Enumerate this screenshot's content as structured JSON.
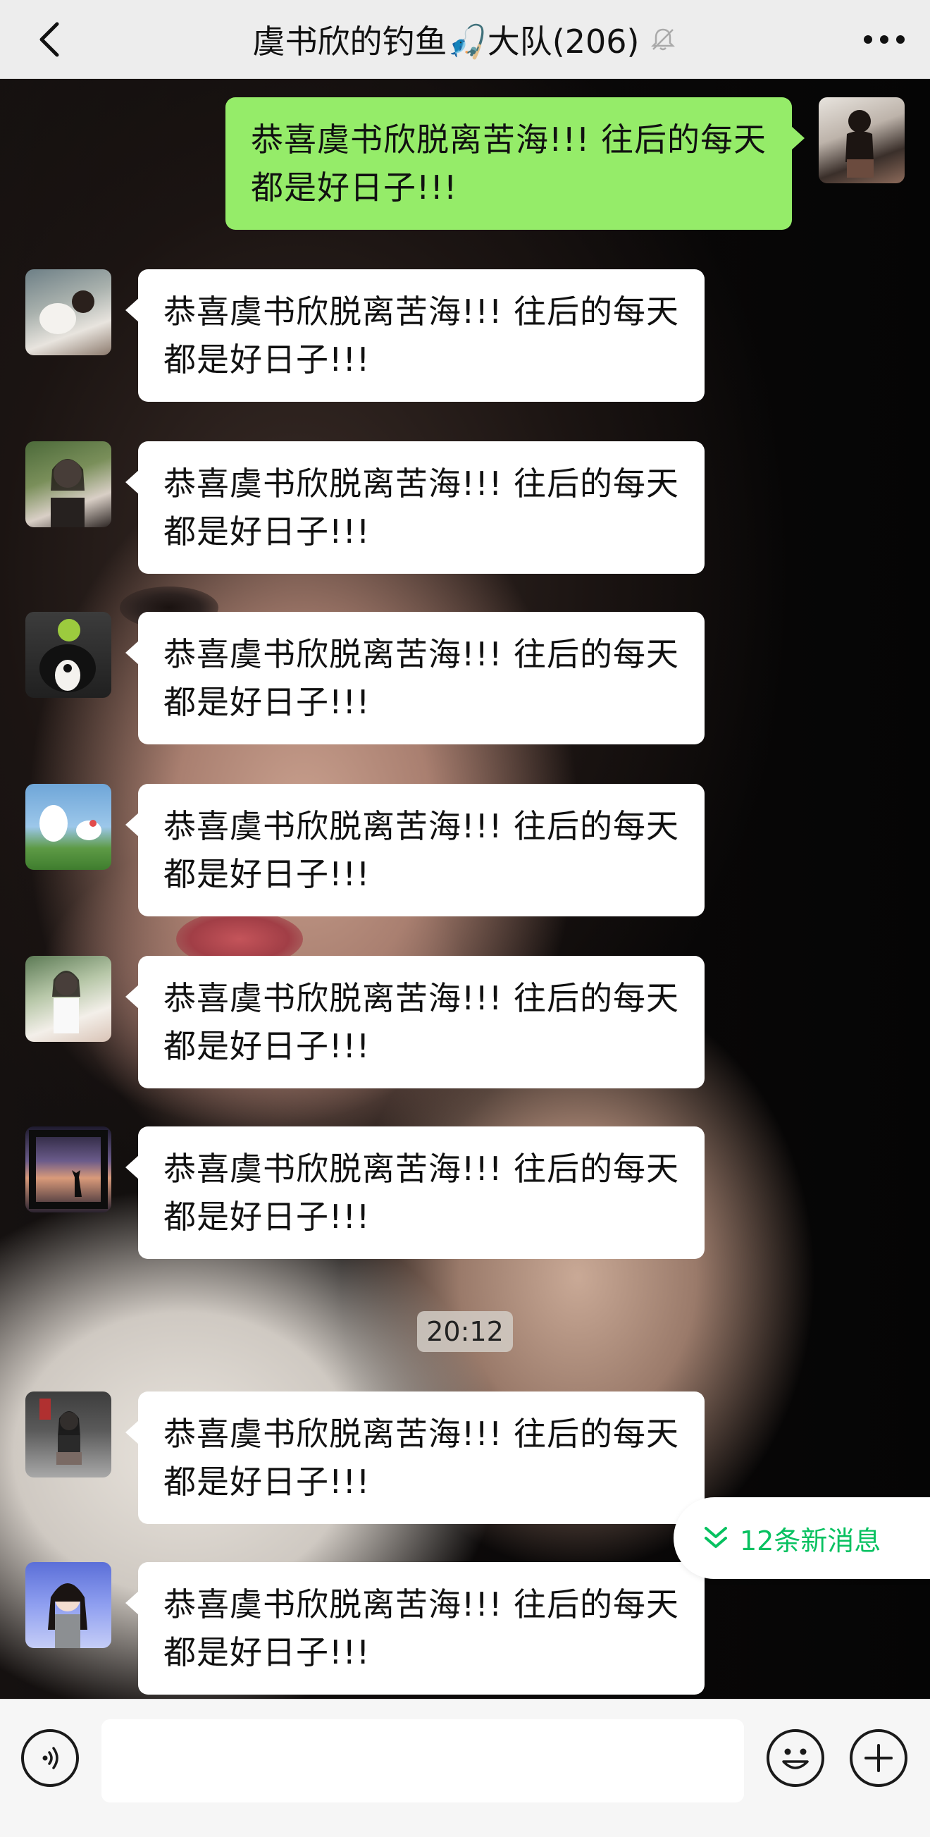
{
  "header": {
    "title": "虞书欣的钓鱼🎣大队(206)",
    "back_icon": "chevron-left-icon",
    "mute_icon": "bell-off-icon",
    "more_icon": "more-dots-icon"
  },
  "messages": [
    {
      "sender": "self",
      "line1": "恭喜虞书欣脱离苦海!!! 往后的每天",
      "line2": "都是好日子!!!"
    },
    {
      "sender": "other",
      "line1": " 恭喜虞书欣脱离苦海!!! 往后的每天",
      "line2": "都是好日子!!!"
    },
    {
      "sender": "other",
      "line1": " 恭喜虞书欣脱离苦海!!! 往后的每天",
      "line2": "都是好日子!!!"
    },
    {
      "sender": "other",
      "line1": "恭喜虞书欣脱离苦海!!! 往后的每天",
      "line2": "都是好日子!!!"
    },
    {
      "sender": "other",
      "line1": " 恭喜虞书欣脱离苦海!!! 往后的每天",
      "line2": "都是好日子!!!"
    },
    {
      "sender": "other",
      "line1": " 恭喜虞书欣脱离苦海!!! 往后的每天",
      "line2": "都是好日子!!!"
    },
    {
      "sender": "other",
      "line1": "恭喜虞书欣脱离苦海!!! 往后的每天",
      "line2": "都是好日子!!!"
    },
    {
      "sender": "other",
      "line1": "恭喜虞书欣脱离苦海!!! 往后的每天",
      "line2": "都是好日子!!!"
    },
    {
      "sender": "other",
      "line1": " 恭喜虞书欣脱离苦海!!! 往后的每天",
      "line2": "都是好日子!!!"
    }
  ],
  "timestamp": "20:12",
  "new_messages": {
    "label": "12条新消息",
    "icon": "double-chevron-down-icon",
    "color": "#07c160"
  },
  "input_bar": {
    "voice_icon": "voice-icon",
    "emoji_icon": "emoji-icon",
    "plus_icon": "plus-icon",
    "input_value": ""
  },
  "colors": {
    "outgoing_bubble": "#95ec69",
    "incoming_bubble": "#ffffff",
    "header_bg": "#ededed"
  }
}
